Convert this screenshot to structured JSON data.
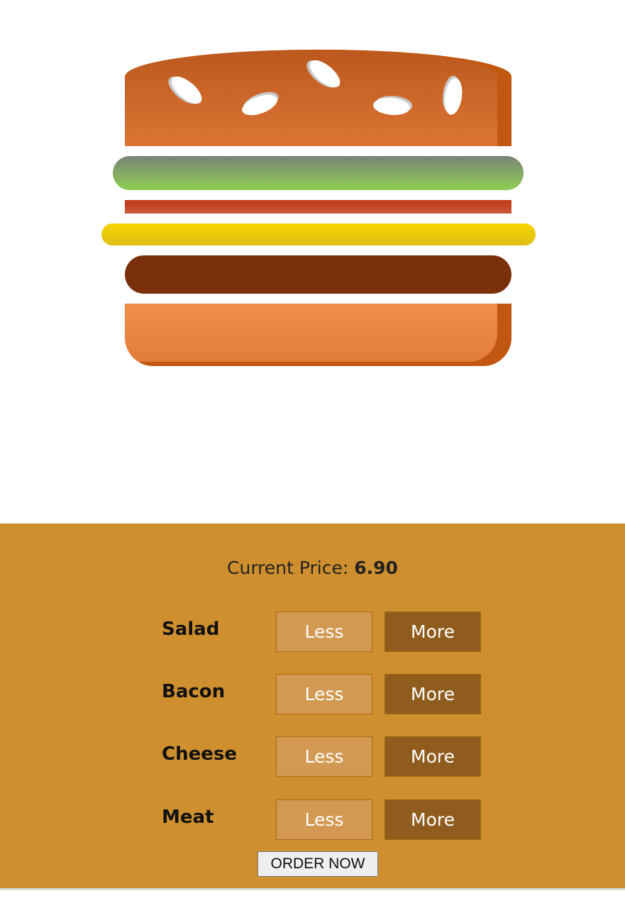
{
  "price": {
    "label": "Current Price: ",
    "value": "6.90"
  },
  "controls": [
    {
      "label": "Salad",
      "less": "Less",
      "more": "More"
    },
    {
      "label": "Bacon",
      "less": "Less",
      "more": "More"
    },
    {
      "label": "Cheese",
      "less": "Less",
      "more": "More"
    },
    {
      "label": "Meat",
      "less": "Less",
      "more": "More"
    }
  ],
  "order_button": "ORDER NOW",
  "colors": {
    "controls_background": "#cf8f2e",
    "less_button": "#d39952",
    "more_button": "#8f5c1e",
    "bread": "#dc7534",
    "salad": "#8cc855",
    "bacon": "#bf3714",
    "cheese": "#f5d500",
    "meat": "#7a300a"
  }
}
